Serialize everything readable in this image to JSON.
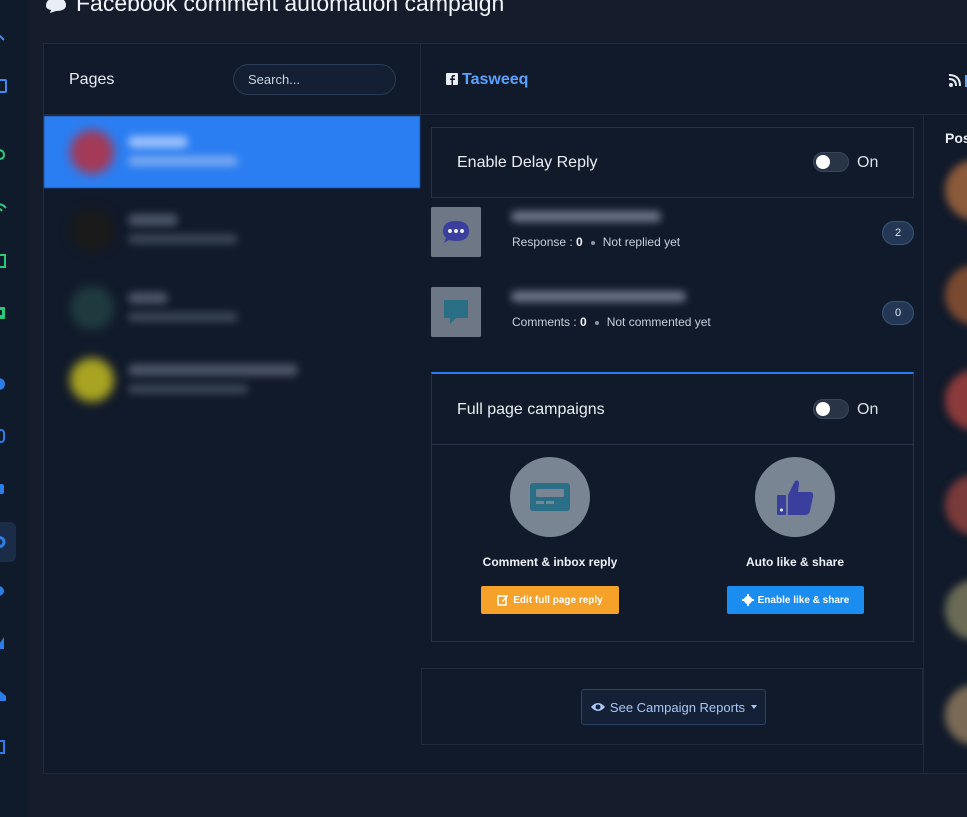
{
  "header": {
    "title": "Facebook comment automation campaign"
  },
  "pages_panel": {
    "label": "Pages",
    "search_placeholder": "Search..."
  },
  "selected_page": {
    "name": "Tasweeq"
  },
  "delay_reply": {
    "title": "Enable Delay Reply",
    "toggle_label": "On"
  },
  "stats": [
    {
      "icon": "chat-bubble-icon",
      "label": "Response :",
      "value": "0",
      "status": "Not replied yet",
      "count": "2"
    },
    {
      "icon": "comment-icon",
      "label": "Comments :",
      "value": "0",
      "status": "Not commented yet",
      "count": "0"
    }
  ],
  "full_page": {
    "title": "Full page campaigns",
    "toggle_label": "On",
    "features": [
      {
        "icon": "message-card-icon",
        "name": "Comment & inbox reply",
        "button": "Edit full page reply",
        "button_icon": "edit-icon"
      },
      {
        "icon": "thumbs-up-icon",
        "name": "Auto like & share",
        "button": "Enable like & share",
        "button_icon": "gear-icon"
      }
    ]
  },
  "reports": {
    "button": "See Campaign Reports"
  },
  "posts_panel": {
    "label": "Post"
  },
  "colors": {
    "accent_blue": "#2b7ef2",
    "link_blue": "#5aa2ff",
    "orange": "#f5a12a",
    "button_blue": "#1b8cf0"
  }
}
